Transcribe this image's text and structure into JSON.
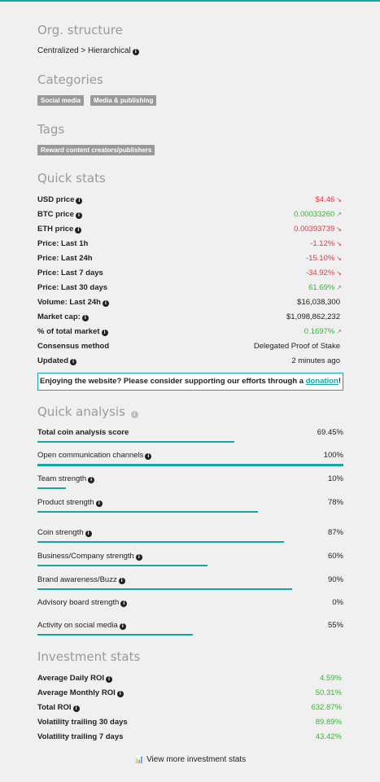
{
  "org": {
    "title": "Org. structure",
    "value": "Centralized > Hierarchical"
  },
  "categories": {
    "title": "Categories",
    "items": [
      "Social media",
      "Media & publishing"
    ]
  },
  "tags": {
    "title": "Tags",
    "items": [
      "Reward content creators/publishers"
    ]
  },
  "quick_stats": {
    "title": "Quick stats",
    "rows": [
      {
        "label": "USD price",
        "value": "$4.46",
        "color": "red",
        "trend": "down",
        "info": true
      },
      {
        "label": "BTC price",
        "value": "0.00033260",
        "color": "green",
        "trend": "up",
        "info": true
      },
      {
        "label": "ETH price",
        "value": "0.00393739",
        "color": "red",
        "trend": "down",
        "info": true
      },
      {
        "label": "Price: Last 1h",
        "value": "-1.12%",
        "color": "red",
        "trend": "down",
        "info": false
      },
      {
        "label": "Price: Last 24h",
        "value": "-15.10%",
        "color": "red",
        "trend": "down",
        "info": false
      },
      {
        "label": "Price: Last 7 days",
        "value": "-34.92%",
        "color": "red",
        "trend": "down",
        "info": false
      },
      {
        "label": "Price: Last 30 days",
        "value": "61.69%",
        "color": "green",
        "trend": "up",
        "info": false
      },
      {
        "label": "Volume: Last 24h",
        "value": "$16,038,300",
        "color": "neutral",
        "trend": "",
        "info": true
      },
      {
        "label": "Market cap:",
        "value": "$1,098,862,232",
        "color": "neutral",
        "trend": "",
        "info": true
      },
      {
        "label": "% of total market",
        "value": "0.1697%",
        "color": "green",
        "trend": "up",
        "info": true
      },
      {
        "label": "Consensus method",
        "value": "Delegated Proof of Stake",
        "color": "neutral",
        "trend": "",
        "info": false
      },
      {
        "label": "Updated",
        "value": "2 minutes ago",
        "color": "neutral",
        "trend": "",
        "info": true
      }
    ]
  },
  "banner": {
    "text": "Enjoying the website? Please consider supporting our efforts through a ",
    "link": "donation",
    "suffix": "!"
  },
  "quick_analysis": {
    "title": "Quick analysis",
    "rows": [
      {
        "label": "Total coin analysis score",
        "value": "69.45%",
        "level": 0.6945,
        "bold": true,
        "info": false
      },
      {
        "label": "Open communication channels",
        "value": "100%",
        "level": 1.0,
        "bold": false,
        "info": true
      },
      {
        "label": "Team strength",
        "value": "10%",
        "level": 0.1,
        "bold": false,
        "info": true
      },
      {
        "label": "Product strength",
        "value": "78%",
        "level": 0.78,
        "bold": false,
        "info": true
      },
      {
        "label": "Coin strength",
        "value": "87%",
        "level": 0.87,
        "bold": false,
        "info": true
      },
      {
        "label": "Business/Company strength",
        "value": "60%",
        "level": 0.6,
        "bold": false,
        "info": true
      },
      {
        "label": "Brand awareness/Buzz",
        "value": "90%",
        "level": 0.9,
        "bold": false,
        "info": true
      },
      {
        "label": "Advisory board strength",
        "value": "0%",
        "level": 0.0,
        "bold": false,
        "info": true
      },
      {
        "label": "Activity on social media",
        "value": "55%",
        "level": 0.55,
        "bold": false,
        "info": true
      }
    ]
  },
  "investment": {
    "title": "Investment stats",
    "rows": [
      {
        "label": "Average Daily ROI",
        "value": "4.59%",
        "info": true
      },
      {
        "label": "Average Monthly ROI",
        "value": "50.31%",
        "info": true
      },
      {
        "label": "Total ROI",
        "value": "632.87%",
        "info": true
      },
      {
        "label": "Volatility trailing 30 days",
        "value": "89.89%",
        "info": false
      },
      {
        "label": "Volatility trailing 7 days",
        "value": "43.42%",
        "info": false
      }
    ],
    "more_link": "View more investment stats"
  },
  "colors": {
    "accent": "#1aa5a5",
    "red": "#e0393e",
    "green": "#3bb23b",
    "tag": "#999999"
  },
  "icons": {
    "info": "info-circle-icon",
    "down": "trend-down-icon",
    "up": "trend-up-icon",
    "chart": "bar-chart-icon"
  }
}
